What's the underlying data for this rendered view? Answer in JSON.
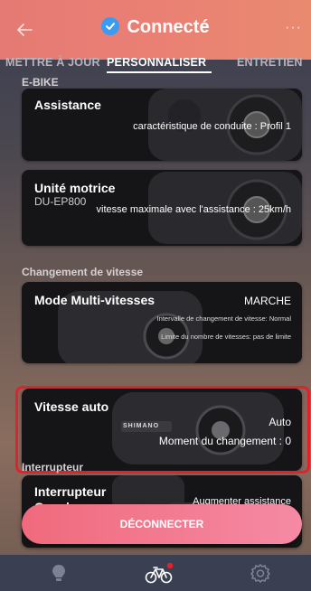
{
  "header": {
    "title": "Connecté",
    "more": "···"
  },
  "tabs": [
    {
      "label": "METTRE À JOUR"
    },
    {
      "label": "PERSONNALISER"
    },
    {
      "label": "ENTRETIEN"
    }
  ],
  "sections": {
    "ebike": "E-BIKE",
    "gearshift": "Changement de vitesse",
    "switch": "Interrupteur"
  },
  "cards": {
    "assistance": {
      "title": "Assistance",
      "value": "caractéristique de conduite : Profil 1"
    },
    "drive_unit": {
      "title": "Unité motrice",
      "subtitle": "DU-EP800",
      "value": "vitesse maximale avec l'assistance : 25km/h"
    },
    "multi_speed": {
      "title": "Mode Multi-vitesses",
      "status": "MARCHE",
      "line1": "Intervalle de changement de vitesse: Normal",
      "line2": "Limite du nombre de vitesses: pas de limite"
    },
    "auto_shift": {
      "title": "Vitesse auto",
      "status": "Auto",
      "value": "Moment du changement : 0",
      "brand": "SHIMANO"
    },
    "switch": {
      "title_line1": "Interrupteur",
      "title_line2": "Gauche",
      "value": "Augmenter assistance"
    }
  },
  "actions": {
    "disconnect": "DÉCONNECTER"
  },
  "bottom_nav": {
    "items": [
      "lightbulb-icon",
      "bike-icon",
      "gear-icon"
    ],
    "active": "bike-icon",
    "badge_color": "#e6202a"
  },
  "colors": {
    "header": "#e47a73",
    "accent": "#3a9bf4",
    "highlight": "#e6202a",
    "button": "#f06a7c"
  }
}
